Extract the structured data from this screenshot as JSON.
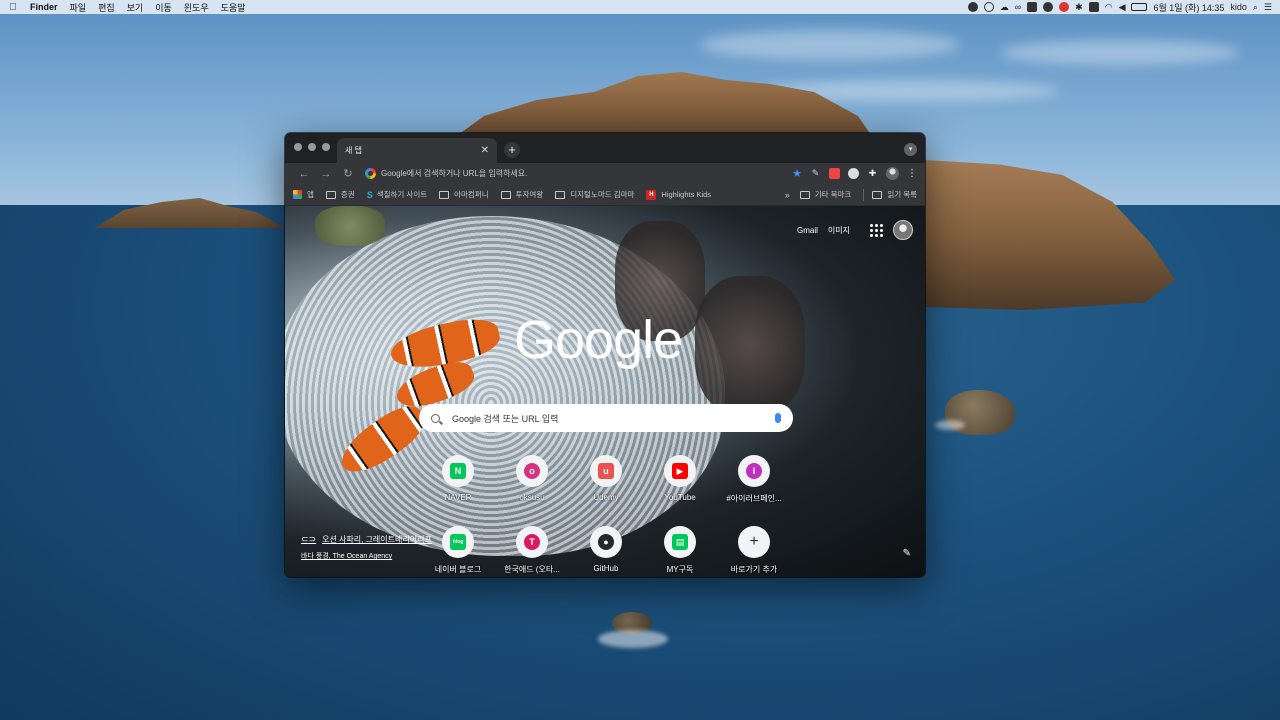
{
  "menubar": {
    "app": "Finder",
    "items": [
      "파일",
      "편집",
      "보기",
      "이동",
      "윈도우",
      "도움말"
    ],
    "datetime": "6월 1일 (화) 14:35",
    "user": "kido"
  },
  "browser": {
    "tab_title": "새 탭",
    "omnibox_placeholder": "Google에서 검색하거나 URL을 입력하세요.",
    "bookmarks": [
      "앱",
      "증권",
      "색칠하기 사이트",
      "아마컴퍼니",
      "투자여왕",
      "디지털노마드 김마마",
      "Highlights Kids"
    ],
    "bookmarks_overflow": "»",
    "other_bookmarks": "기타 북마크",
    "reading_list": "읽기 목록"
  },
  "ntp": {
    "gmail": "Gmail",
    "images": "이미지",
    "logo": "Google",
    "search_placeholder": "Google 검색 또는 URL 입력",
    "shortcuts": [
      {
        "label": "NAVER",
        "glyph": "N",
        "color": "#03c75a"
      },
      {
        "label": "oksusu",
        "glyph": "o",
        "color": "#d63384"
      },
      {
        "label": "Udemy",
        "glyph": "u",
        "color": "#ec5252"
      },
      {
        "label": "YouTube",
        "glyph": "▶",
        "color": "#ff0000"
      },
      {
        "label": "#아이러브페인...",
        "glyph": "I",
        "color": "#c02fbf"
      },
      {
        "label": "네이버 블로그",
        "glyph": "blog",
        "color": "#03c75a"
      },
      {
        "label": "한국애드 (오타...",
        "glyph": "T",
        "color": "#d81b60"
      },
      {
        "label": "GitHub",
        "glyph": "●",
        "color": "#24292e"
      },
      {
        "label": "MY구독",
        "glyph": "▤",
        "color": "#03c75a"
      },
      {
        "label": "바로가기 추가",
        "glyph": "+",
        "color": "#f1f3f4"
      }
    ],
    "attribution_title": "오션 사파리, 그레이트배리어리프",
    "attribution_credit": "바다 풍경, The Ocean Agency"
  }
}
